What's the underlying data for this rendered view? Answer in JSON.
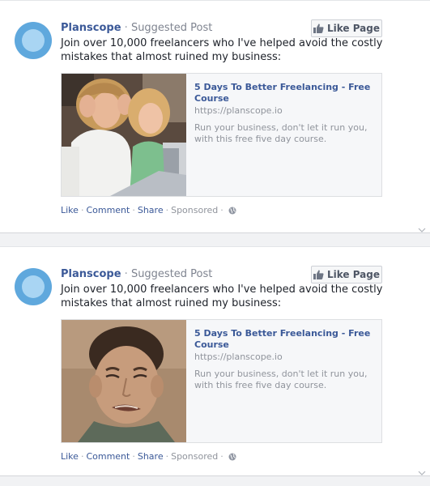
{
  "posts": [
    {
      "page_name": "Planscope",
      "post_type": "Suggested Post",
      "like_button": "Like Page",
      "text": "Join over 10,000 freelancers who I've helped avoid the costly mistakes that almost ruined my business:",
      "link": {
        "title": "5 Days To Better Freelancing - Free Course",
        "domain": "https://planscope.io",
        "description": "Run your business, don't let it run you, with this free five day course."
      },
      "actions": {
        "like": "Like",
        "comment": "Comment",
        "share": "Share",
        "sponsored": "Sponsored"
      },
      "icons": {
        "avatar": "planscope-logo",
        "like_button": "thumbs-up-icon",
        "audience": "globe-icon",
        "image": "stressed-women-at-laptop-photo"
      }
    },
    {
      "page_name": "Planscope",
      "post_type": "Suggested Post",
      "like_button": "Like Page",
      "text": "Join over 10,000 freelancers who I've helped avoid the costly mistakes that almost ruined my business:",
      "link": {
        "title": "5 Days To Better Freelancing - Free Course",
        "domain": "https://planscope.io",
        "description": "Run your business, don't let it run you, with this free five day course."
      },
      "actions": {
        "like": "Like",
        "comment": "Comment",
        "share": "Share",
        "sponsored": "Sponsored"
      },
      "icons": {
        "avatar": "planscope-logo",
        "like_button": "thumbs-up-icon",
        "audience": "globe-icon",
        "image": "grimacing-man-photo"
      }
    }
  ],
  "separators": {
    "dot": "·"
  },
  "colors": {
    "link": "#3b5998",
    "avatar_outer": "#5fa8dd",
    "avatar_inner": "#a9d5f3",
    "meta": "#90949c"
  }
}
